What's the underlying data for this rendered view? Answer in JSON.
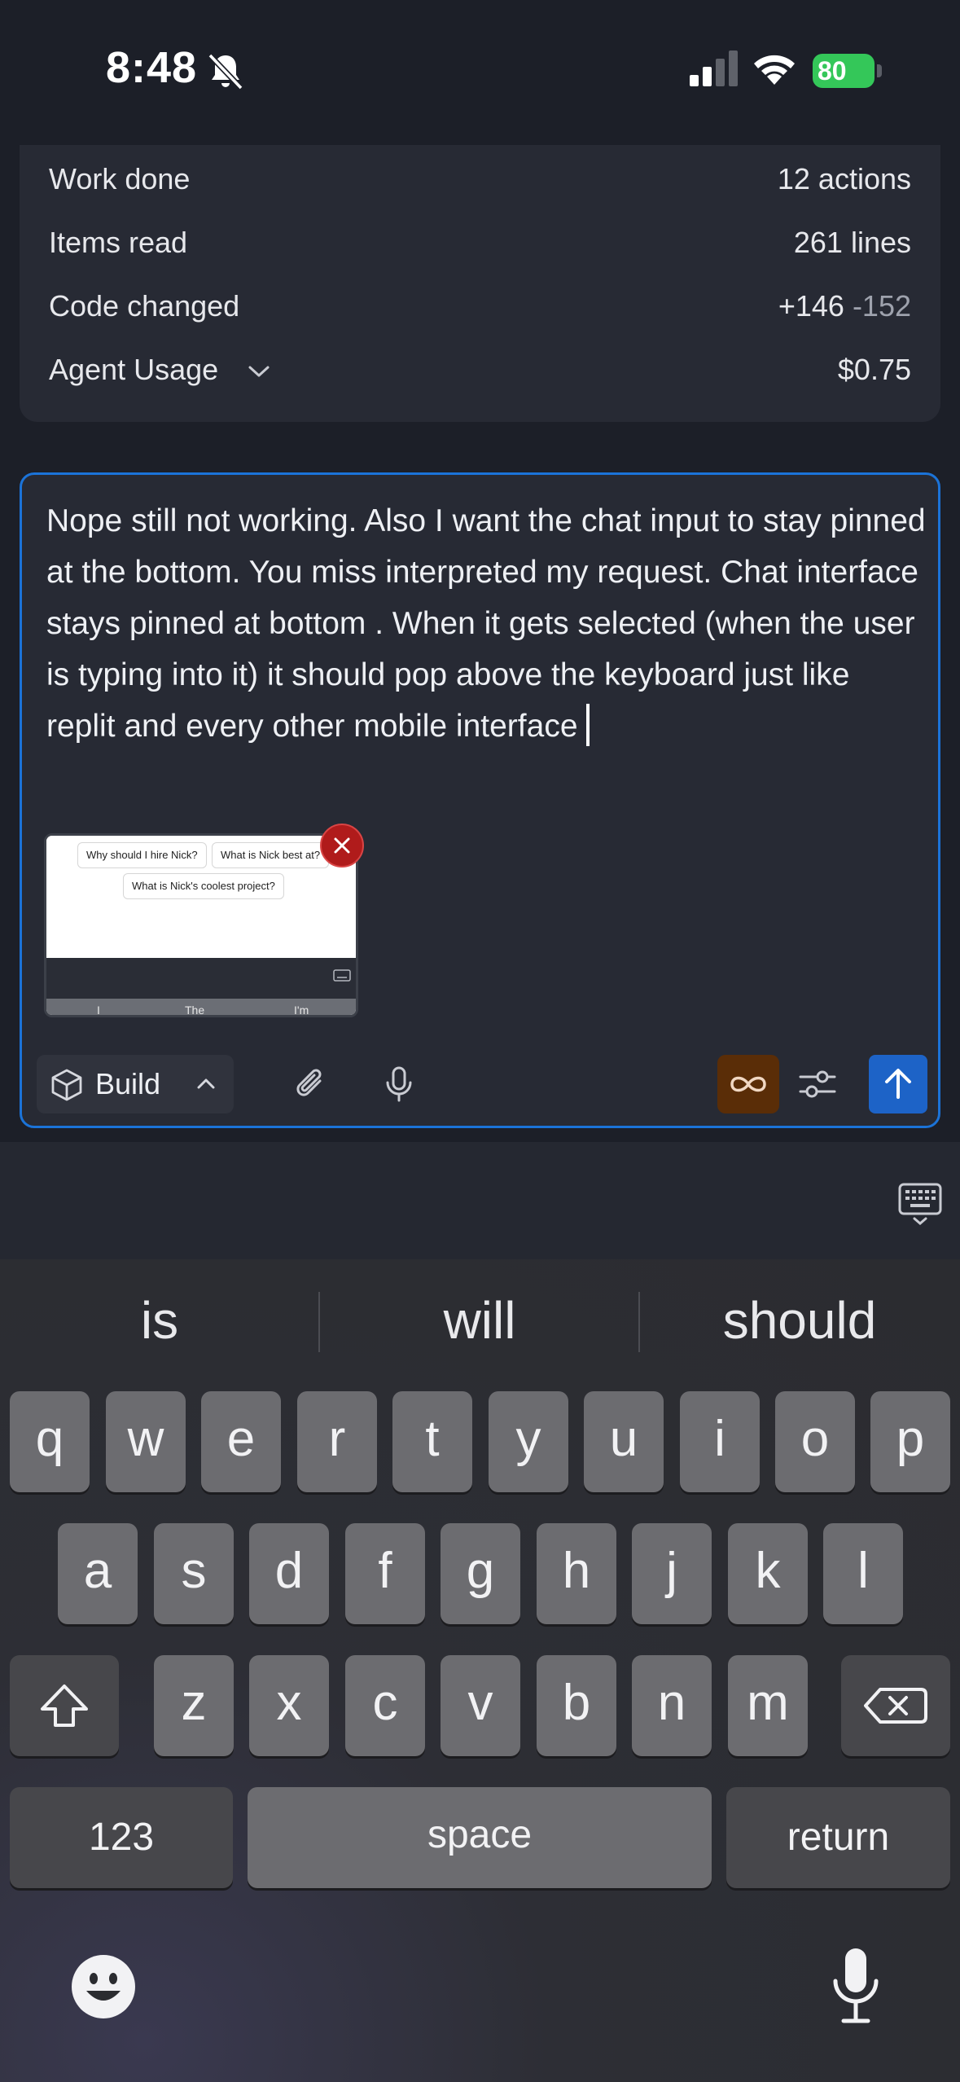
{
  "status_bar": {
    "time": "8:48",
    "battery": "80"
  },
  "summary": {
    "rows": [
      {
        "label": "Work done",
        "value": "12 actions"
      },
      {
        "label": "Items read",
        "value": "261 lines"
      },
      {
        "label": "Code changed",
        "added": "+146",
        "removed": "-152"
      },
      {
        "label": "Agent Usage",
        "value": "$0.75"
      }
    ]
  },
  "input": {
    "text": "Nope still not working. Also I want the chat input to stay pinned at the bottom. You miss interpreted my request. Chat interface stays pinned at bottom . When it gets selected (when the user is typing into it) it should pop above the keyboard just like replit and every other mobile interface",
    "attachment": {
      "chips": [
        "Why should I hire Nick?",
        "What is Nick best at?",
        "What is Nick's coolest project?"
      ],
      "keyboard_hints": [
        "I",
        "The",
        "I'm"
      ]
    }
  },
  "toolbar": {
    "mode_label": "Build"
  },
  "keyboard": {
    "suggestions": [
      "is",
      "will",
      "should"
    ],
    "row1": [
      "q",
      "w",
      "e",
      "r",
      "t",
      "y",
      "u",
      "i",
      "o",
      "p"
    ],
    "row2": [
      "a",
      "s",
      "d",
      "f",
      "g",
      "h",
      "j",
      "k",
      "l"
    ],
    "row3": [
      "z",
      "x",
      "c",
      "v",
      "b",
      "n",
      "m"
    ],
    "numbers_label": "123",
    "space_label": "space",
    "return_label": "return"
  },
  "colors": {
    "accent": "#1b73d8",
    "send": "#1d63c7",
    "infinity_bg": "#5a2d07",
    "remove": "#b01b1b",
    "battery": "#34c759"
  }
}
